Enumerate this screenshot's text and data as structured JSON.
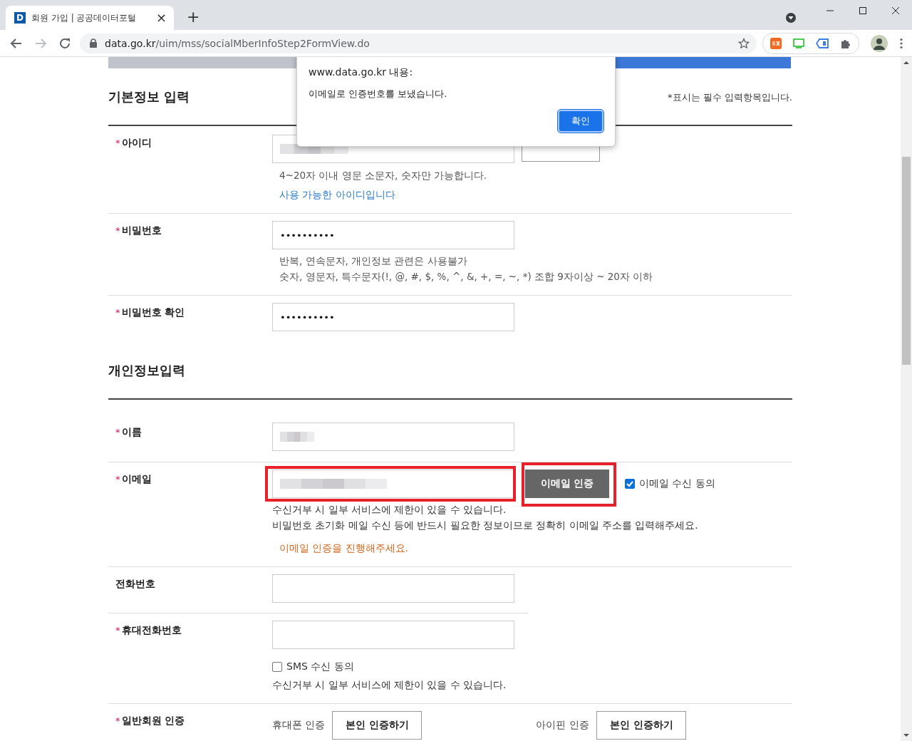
{
  "browser": {
    "tab": {
      "favicon": "D",
      "title": "회원 가입 | 공공데이터포털",
      "close": "×"
    },
    "new_tab": "+",
    "url": {
      "host": "data.go.kr",
      "path": "/uim/mss/socialMberInfoStep2FormView.do"
    }
  },
  "sections": [
    {
      "title": "기본정보 입력",
      "note": "*표시는 필수 입력항목입니다.",
      "rows": [
        {
          "label": "아이디",
          "required_mark": "*",
          "field": {
            "kind": "redacted"
          },
          "button": {
            "kind": "covered"
          },
          "hints": [
            {
              "text": "4~20자 이내 영문 소문자, 숫자만 가능합니다.",
              "kind": "guide"
            },
            {
              "text": "사용 가능한 아이디입니다",
              "kind": "success"
            }
          ]
        },
        {
          "label": "비밀번호",
          "required_mark": "*",
          "field": {
            "kind": "password",
            "value": "••••••••••"
          },
          "hints": [
            {
              "text": "반복, 연속문자, 개인정보 관련은 사용불가",
              "kind": "guide"
            },
            {
              "text": "숫자, 영문자, 특수문자(!, @, #, $, %, ^, &, +, =, ~, *) 조합 9자이상 ~ 20자 이하",
              "kind": "guide"
            }
          ]
        },
        {
          "label": "비밀번호 확인",
          "required_mark": "*",
          "field": {
            "kind": "password",
            "value": "••••••••••"
          }
        }
      ]
    },
    {
      "title": "개인정보입력",
      "rows": [
        {
          "label": "이름",
          "required_mark": "*",
          "field": {
            "kind": "redacted"
          }
        },
        {
          "label": "이메일",
          "required_mark": "*",
          "field": {
            "kind": "redacted",
            "highlighted": true
          },
          "button": {
            "label": "이메일 인증",
            "kind": "verify",
            "highlighted": true
          },
          "checkbox": {
            "label": "이메일 수신 동의",
            "checked": true
          },
          "hints": [
            {
              "text": "수신거부 시 일부 서비스에 제한이 있을 수 있습니다.",
              "kind": "notice"
            },
            {
              "text": "비밀번호 초기화 메일 수신 등에 반드시 필요한 정보이므로 정확히 이메일 주소를 입력해주세요.",
              "kind": "notice"
            },
            {
              "text": "이메일 인증을 진행해주세요.",
              "kind": "error"
            }
          ]
        },
        {
          "label": "전화번호",
          "field": {
            "kind": "text"
          }
        },
        {
          "label": "휴대전화번호",
          "required_mark": "*",
          "field": {
            "kind": "text"
          },
          "sub_checkbox": {
            "label": "SMS 수신 동의",
            "checked": false
          },
          "hints": [
            {
              "text": "수신거부 시 일부 서비스에 제한이 있을 수 있습니다.",
              "kind": "notice"
            }
          ]
        },
        {
          "label": "일반회원 인증",
          "required_mark": "*",
          "field": {
            "kind": "auth"
          },
          "options": [
            {
              "label": "휴대폰 인증",
              "button": "본인 인증하기"
            },
            {
              "label": "아이핀 인증",
              "button": "본인 인증하기"
            }
          ]
        }
      ]
    }
  ],
  "dialog": {
    "title": "www.data.go.kr 내용:",
    "message": "이메일로 인증번호를 보냈습니다.",
    "button": "확인"
  }
}
